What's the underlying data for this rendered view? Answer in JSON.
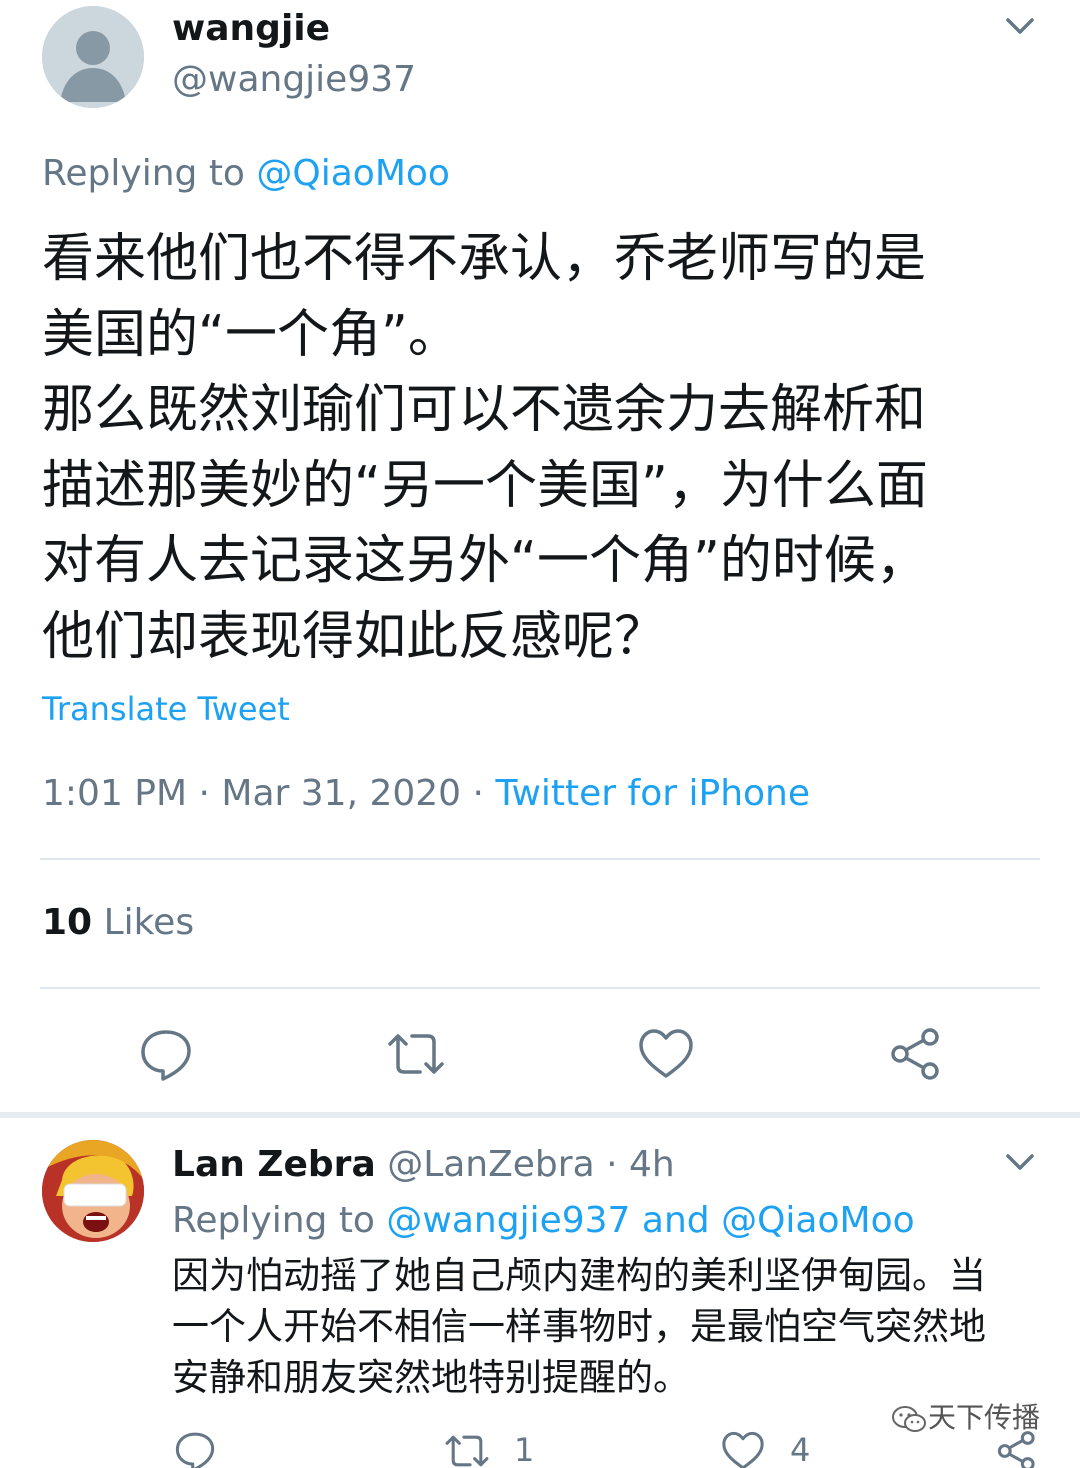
{
  "tweet": {
    "author_name": "wangjie",
    "author_handle": "@wangjie937",
    "replying_prefix": "Replying to ",
    "replying_handle": "@QiaoMoo",
    "body_lines": [
      "看来他们也不得不承认，乔老师写的是",
      "美国的“一个角”。",
      "那么既然刘瑜们可以不遗余力去解析和",
      "描述那美妙的“另一个美国”，为什么面",
      "对有人去记录这另外“一个角”的时候，",
      "他们却表现得如此反感呢？"
    ],
    "translate_label": "Translate Tweet",
    "time": "1:01 PM",
    "date": "Mar 31, 2020",
    "separator": " · ",
    "client": "Twitter for iPhone",
    "likes_count": "10",
    "likes_label": "Likes"
  },
  "actions": {
    "reply_icon": "reply-icon",
    "retweet_icon": "retweet-icon",
    "like_icon": "heart-icon",
    "share_icon": "share-icon"
  },
  "reply": {
    "author_name": "Lan Zebra",
    "author_handle": "@LanZebra",
    "time": "4h",
    "replying_prefix": "Replying to ",
    "replying_handle_1": "@wangjie937",
    "replying_and": "and",
    "replying_handle_2": "@QiaoMoo",
    "body_lines": [
      "因为怕动摇了她自己颅内建构的美利坚伊甸园。当",
      "一个人开始不相信一样事物时，是最怕空气突然地",
      "安静和朋友突然地特别提醒的。"
    ],
    "retweet_count": "1",
    "like_count": "4"
  },
  "watermark": "天下传播",
  "colors": {
    "link_blue": "#1da1f2",
    "secondary_gray": "#657786",
    "text_black": "#14171a",
    "divider": "#e1e8ed"
  }
}
